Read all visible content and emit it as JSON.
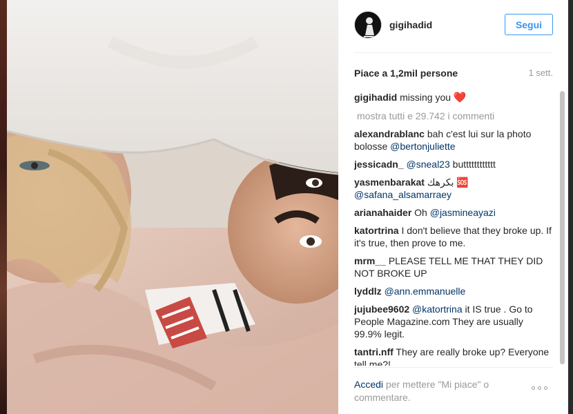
{
  "post": {
    "username": "gigihadid",
    "follow_label": "Segui",
    "likes_text": "Piace a 1,2mil persone",
    "time_ago": "1 sett.",
    "caption": {
      "user": "gigihadid",
      "text": "missing you",
      "heart": "❤️"
    },
    "load_more": "mostra tutti e 29.742 i commenti"
  },
  "comments": [
    {
      "user": "alexandrablanc",
      "text": "bah c'est lui sur la photo bolosse ",
      "mention": "@bertonjuliette"
    },
    {
      "user": "jessicadn_",
      "text": "",
      "mention": "@sneal23",
      "after": " butttttttttttt"
    },
    {
      "user": "yasmenbarakat",
      "text": "بكرهك 🆘 ",
      "mention": "@safana_alsamarraey"
    },
    {
      "user": "arianahaider",
      "text": "Oh ",
      "mention": "@jasmineayazi"
    },
    {
      "user": "katortrina",
      "text": "I don't believe that they broke up. If it's true, then prove to me."
    },
    {
      "user": "mrm__",
      "text": "PLEASE TELL ME THAT THEY DID NOT BROKE UP"
    },
    {
      "user": "lyddlz",
      "text": "",
      "mention": "@ann.emmanuelle"
    },
    {
      "user": "jujubee9602",
      "text": "",
      "mention": "@katortrina",
      "after": " it IS true . Go to People Magazine.com They are usually 99.9% legit."
    },
    {
      "user": "tantri.nff",
      "text": "They are really broke up? Everyone tell me?!"
    }
  ],
  "footer": {
    "login_link": "Accedi",
    "login_text": " per mettere \"Mi piace\" o commentare."
  },
  "icons": {
    "more": "more-options-icon",
    "avatar": "profile-avatar"
  }
}
